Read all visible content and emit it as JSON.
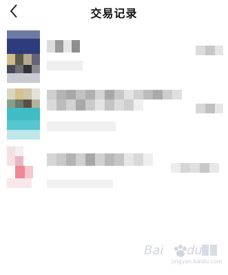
{
  "header": {
    "title": "交易记录",
    "back_icon": "chevron-left-icon"
  },
  "watermark": {
    "url": "jingyan.baidu.com",
    "logo_icon": "baidu-jingyan-logo"
  },
  "colors": {
    "background": "#ffffff",
    "text": "#111111"
  }
}
